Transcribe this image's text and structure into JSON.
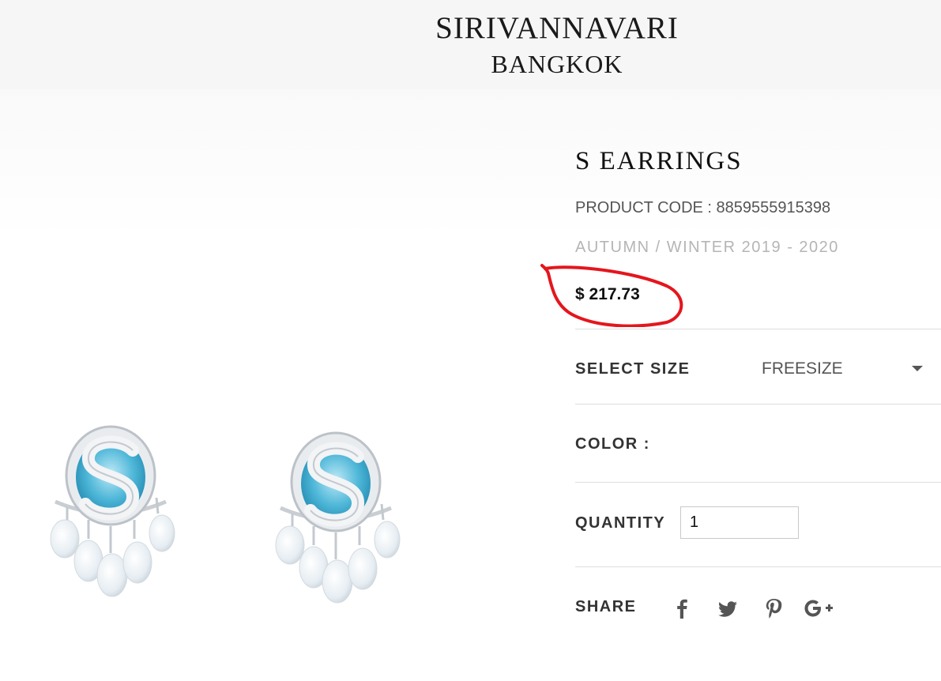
{
  "brand": {
    "line1": "SIRIVANNAVARI",
    "line2": "BANGKOK"
  },
  "product": {
    "title": "S EARRINGS",
    "code_text": "PRODUCT CODE : 8859555915398",
    "season": "AUTUMN / WINTER 2019 - 2020",
    "price": "$ 217.73",
    "image_icon": "earrings-image"
  },
  "size": {
    "label": "SELECT SIZE",
    "selected": "FREESIZE"
  },
  "color": {
    "label": "COLOR :"
  },
  "quantity": {
    "label": "QUANTITY",
    "value": "1"
  },
  "share": {
    "label": "SHARE",
    "icons": [
      "facebook-icon",
      "twitter-icon",
      "pinterest-icon",
      "google-plus-icon"
    ]
  },
  "colors": {
    "annotation": "#e4161d",
    "gem": "#4fb7d8",
    "header_bg": "#f6f6f6"
  }
}
